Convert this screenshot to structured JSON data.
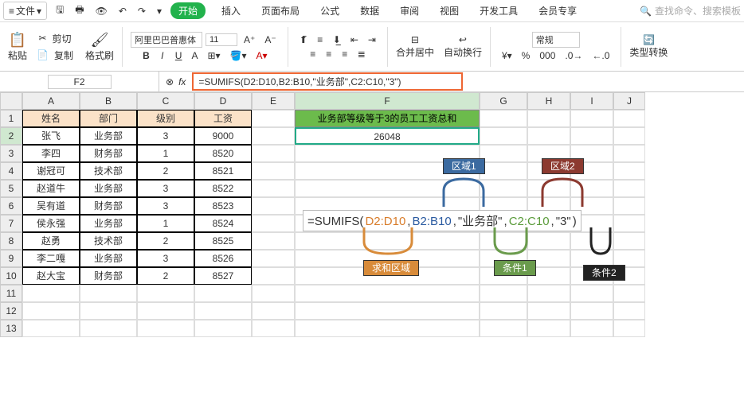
{
  "menubar": {
    "file": "文件",
    "icons": [
      "menu-icon",
      "dropdown-arrow",
      "undo-icon",
      "save-icon",
      "print-icon",
      "preview-icon",
      "undo2-icon",
      "redo-icon"
    ]
  },
  "tabs": {
    "items": [
      "开始",
      "插入",
      "页面布局",
      "公式",
      "数据",
      "审阅",
      "视图",
      "开发工具",
      "会员专享"
    ],
    "activeIndex": 0,
    "search": "查找命令、搜索模板"
  },
  "ribbon": {
    "paste": "粘贴",
    "cut": "剪切",
    "copy": "复制",
    "fmt": "格式刷",
    "font": "阿里巴巴普惠体",
    "size": "11",
    "bold": "B",
    "italic": "I",
    "underline": "U",
    "strike": "A",
    "merge": "合并居中",
    "wrap": "自动换行",
    "numfmt": "常规",
    "typeconv": "类型转换"
  },
  "fbar": {
    "name": "F2",
    "fx": "fx",
    "formula": "=SUMIFS(D2:D10,B2:B10,\"业务部\",C2:C10,\"3\")"
  },
  "cols": [
    "A",
    "B",
    "C",
    "D",
    "E",
    "F",
    "G",
    "H",
    "I",
    "J"
  ],
  "sheet": {
    "headers": [
      "姓名",
      "部门",
      "级别",
      "工资"
    ],
    "rows": [
      {
        "n": "张飞",
        "d": "业务部",
        "l": "3",
        "s": "9000"
      },
      {
        "n": "李四",
        "d": "财务部",
        "l": "1",
        "s": "8520"
      },
      {
        "n": "谢冠可",
        "d": "技术部",
        "l": "2",
        "s": "8521"
      },
      {
        "n": "赵道牛",
        "d": "业务部",
        "l": "3",
        "s": "8522"
      },
      {
        "n": "吴有道",
        "d": "财务部",
        "l": "3",
        "s": "8523"
      },
      {
        "n": "侯永强",
        "d": "业务部",
        "l": "1",
        "s": "8524"
      },
      {
        "n": "赵勇",
        "d": "技术部",
        "l": "2",
        "s": "8525"
      },
      {
        "n": "李二嘎",
        "d": "业务部",
        "l": "3",
        "s": "8526"
      },
      {
        "n": "赵大宝",
        "d": "财务部",
        "l": "2",
        "s": "8527"
      }
    ],
    "greenHeader": "业务部等级等于3的员工工资总和",
    "result": "26048"
  },
  "annotate": {
    "area1": "区域1",
    "area2": "区域2",
    "sumarea": "求和区域",
    "cond1": "条件1",
    "cond2": "条件2",
    "formula": {
      "fn": "=SUMIFS(",
      "p1": "D2:D10",
      "c": ",",
      "p2": "B2:B10",
      "p3": "\"业务部\"",
      "p4": "C2:C10",
      "p5": "\"3\"",
      "end": ")"
    }
  }
}
